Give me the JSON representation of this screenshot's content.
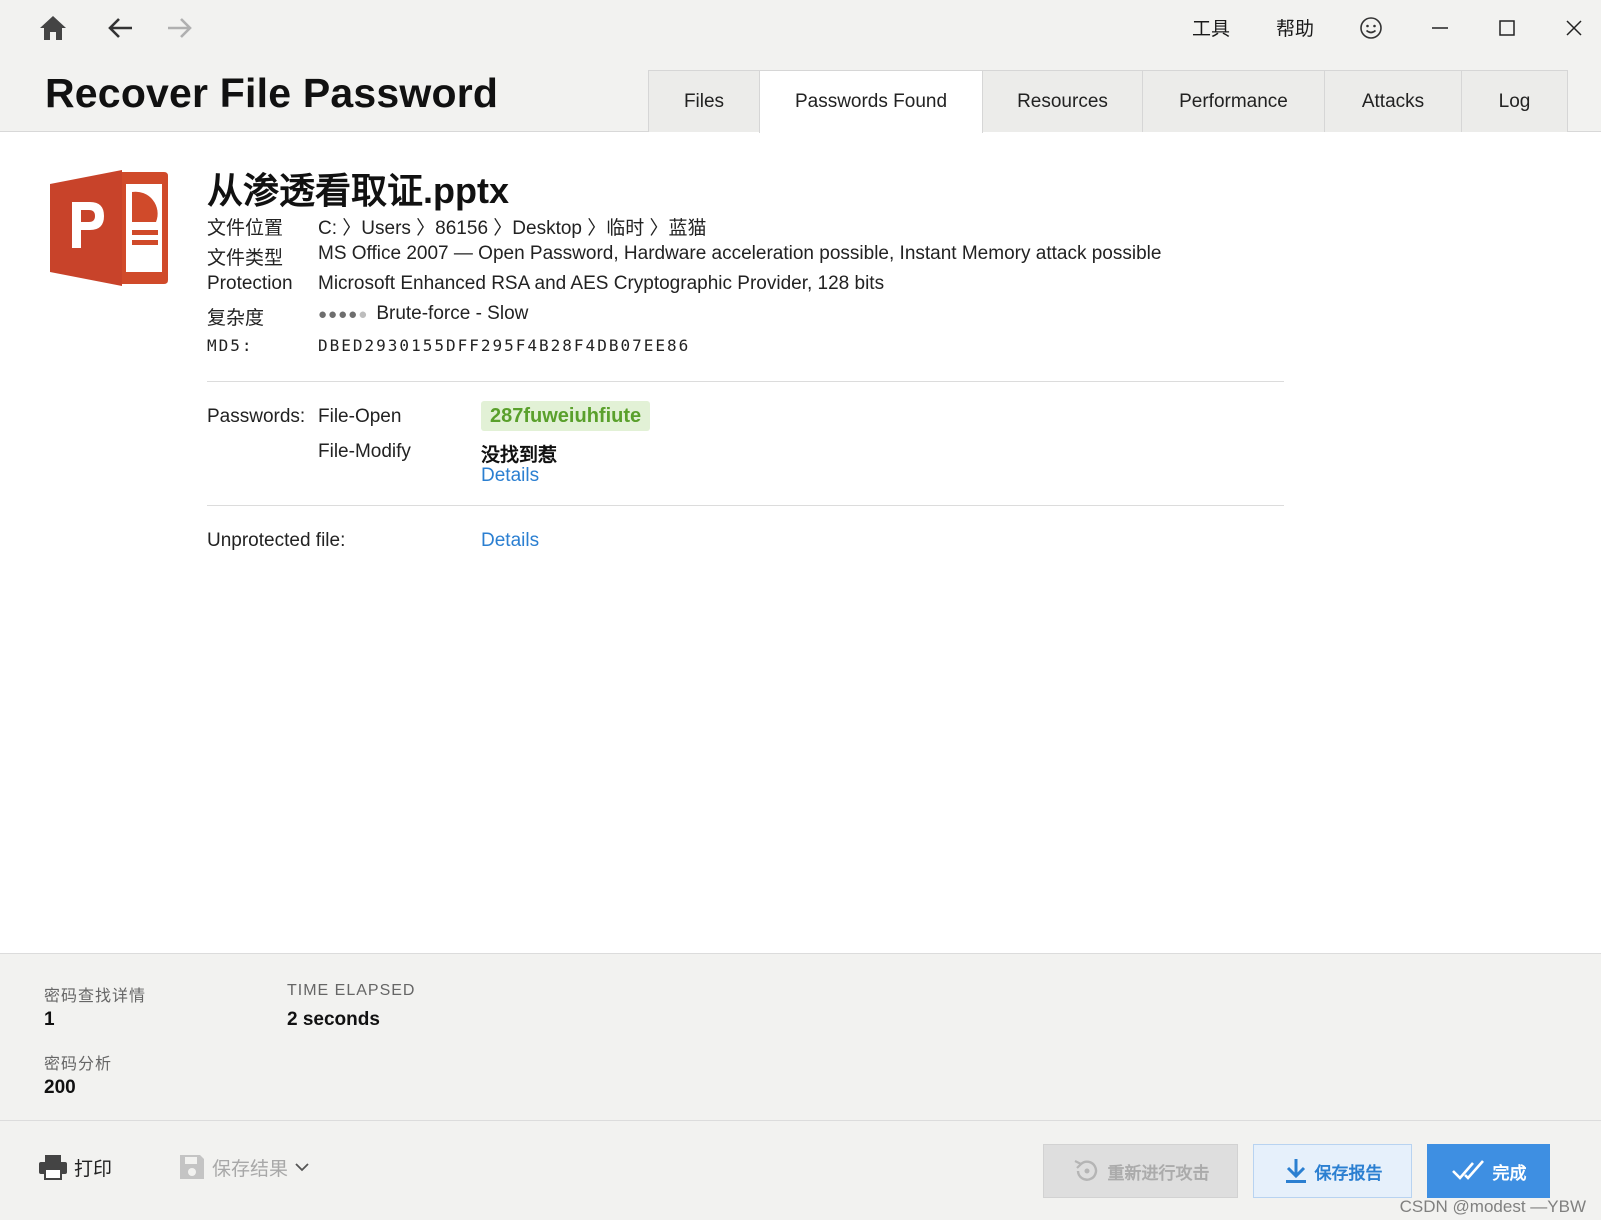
{
  "nav": {
    "home_icon": "home-icon",
    "back_icon": "arrow-left-icon",
    "forward_icon": "arrow-right-icon"
  },
  "menu": {
    "tools": "工具",
    "help": "帮助"
  },
  "app_title": "Recover File Password",
  "tabs": [
    {
      "label": "Files"
    },
    {
      "label": "Passwords Found",
      "active": true
    },
    {
      "label": "Resources"
    },
    {
      "label": "Performance"
    },
    {
      "label": "Attacks"
    },
    {
      "label": "Log"
    }
  ],
  "file": {
    "name": "从渗透看取证.pptx",
    "location_label": "文件位置",
    "location": "C: 〉Users 〉86156 〉Desktop 〉临时 〉蓝猫",
    "type_label": "文件类型",
    "type": "MS Office 2007 — Open Password, Hardware acceleration possible, Instant Memory attack possible",
    "protection_label": "Protection",
    "protection": "Microsoft Enhanced RSA and AES Cryptographic Provider, 128 bits",
    "complexity_label": "复杂度",
    "complexity_dots_filled": "●●●●",
    "complexity_dots_empty": "●",
    "complexity": "Brute-force - Slow",
    "md5_label": "MD5:",
    "md5": "DBED2930155DFF295F4B28F4DB07EE86"
  },
  "passwords": {
    "label": "Passwords:",
    "open_label": "File-Open",
    "open_value": "287fuweiuhfiute",
    "modify_label": "File-Modify",
    "modify_value": "没找到惹",
    "details_link": "Details",
    "unprotected_label": "Unprotected file:",
    "unprotected_link": "Details"
  },
  "stats": {
    "found_label": "密码查找详情",
    "found_value": "1",
    "elapsed_label": "TIME ELAPSED",
    "elapsed_value": "2 seconds",
    "analysis_label": "密码分析",
    "analysis_value": "200"
  },
  "footer": {
    "print": "打印",
    "save_results": "保存结果",
    "restart": "重新进行攻击",
    "save_report": "保存报告",
    "done": "完成"
  },
  "watermark": "CSDN @modest —YBW",
  "colors": {
    "accent": "#3e8fe2",
    "link": "#2b7fd1",
    "found_bg": "#e2f1d6",
    "found_text": "#5aa02c",
    "ppt_orange": "#d04a2a"
  }
}
